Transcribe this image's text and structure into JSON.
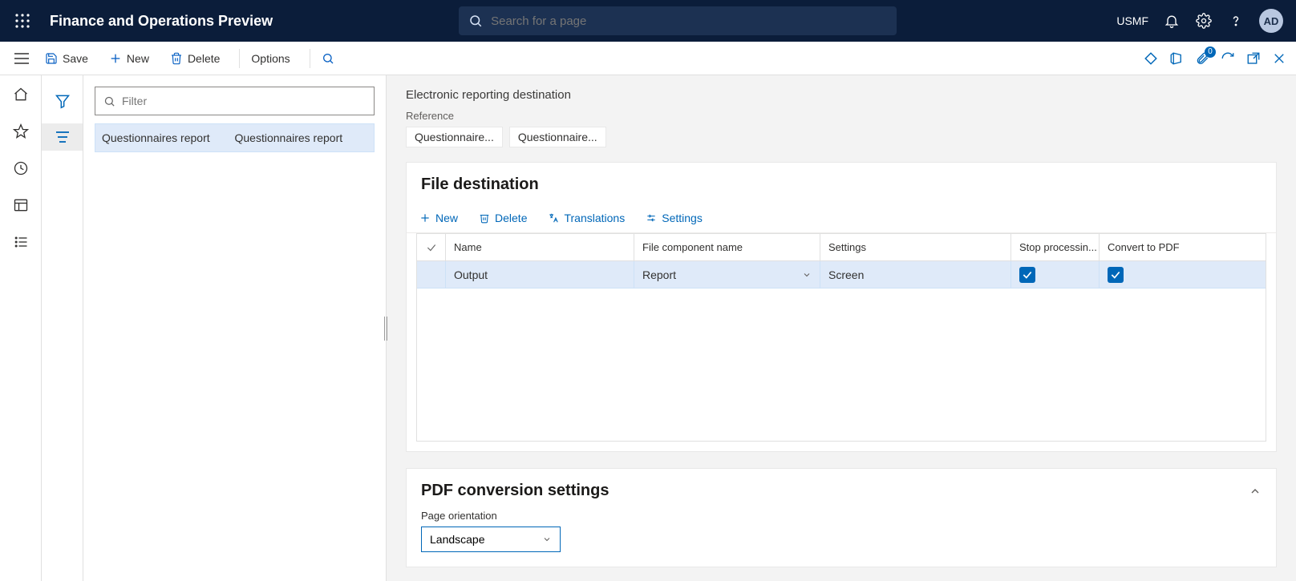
{
  "header": {
    "brand": "Finance and Operations Preview",
    "search_placeholder": "Search for a page",
    "company": "USMF",
    "avatar": "AD"
  },
  "actionbar": {
    "save": "Save",
    "new": "New",
    "delete": "Delete",
    "options": "Options",
    "badge_count": "0"
  },
  "list": {
    "filter_placeholder": "Filter",
    "item_col1": "Questionnaires report",
    "item_col2": "Questionnaires report"
  },
  "page": {
    "title": "Electronic reporting destination",
    "reference_label": "Reference",
    "ref_chip1": "Questionnaire...",
    "ref_chip2": "Questionnaire..."
  },
  "file_dest": {
    "title": "File destination",
    "toolbar": {
      "new": "New",
      "delete": "Delete",
      "translations": "Translations",
      "settings": "Settings"
    },
    "columns": {
      "name": "Name",
      "file": "File component name",
      "settings": "Settings",
      "stop": "Stop processin...",
      "pdf": "Convert to PDF"
    },
    "row": {
      "name": "Output",
      "file": "Report",
      "settings": "Screen",
      "stop": true,
      "pdf": true
    }
  },
  "pdf_conv": {
    "title": "PDF conversion settings",
    "orientation_label": "Page orientation",
    "orientation_value": "Landscape"
  }
}
